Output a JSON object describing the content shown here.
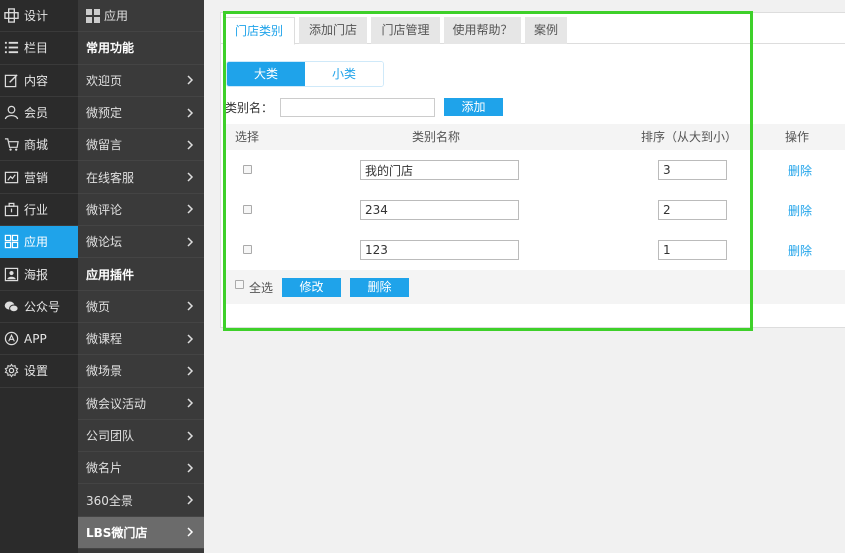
{
  "nav1": [
    {
      "label": "设计",
      "icon": "design-icon",
      "active": false
    },
    {
      "label": "栏目",
      "icon": "list-icon",
      "active": false
    },
    {
      "label": "内容",
      "icon": "edit-icon",
      "active": false
    },
    {
      "label": "会员",
      "icon": "user-icon",
      "active": false
    },
    {
      "label": "商城",
      "icon": "cart-icon",
      "active": false
    },
    {
      "label": "营销",
      "icon": "marketing-icon",
      "active": false
    },
    {
      "label": "行业",
      "icon": "briefcase-icon",
      "active": false
    },
    {
      "label": "应用",
      "icon": "apps-grid-icon",
      "active": true
    },
    {
      "label": "海报",
      "icon": "poster-icon",
      "active": false
    },
    {
      "label": "公众号",
      "icon": "wechat-icon",
      "active": false
    },
    {
      "label": "APP",
      "icon": "app-icon",
      "active": false
    },
    {
      "label": "设置",
      "icon": "gear-icon",
      "active": false
    }
  ],
  "nav2": {
    "title": "应用",
    "sections": [
      {
        "heading": "常用功能",
        "items": [
          "欢迎页",
          "微预定",
          "微留言",
          "在线客服",
          "微评论",
          "微论坛"
        ]
      },
      {
        "heading": "应用插件",
        "items": [
          "微页",
          "微课程",
          "微场景",
          "微会议活动",
          "公司团队",
          "微名片",
          "360全景",
          "LBS微门店"
        ]
      }
    ],
    "selected": "LBS微门店"
  },
  "tabs": [
    "门店类别",
    "添加门店",
    "门店管理",
    "使用帮助？",
    "案例"
  ],
  "active_tab": "门店类别",
  "segment": {
    "big": "大类",
    "small": "小类"
  },
  "add_form": {
    "label": "类别名：",
    "input_value": "",
    "button": "添加"
  },
  "table": {
    "headers": {
      "select": "选择",
      "name": "类别名称",
      "sort": "排序（从大到小）",
      "action": "操作"
    },
    "rows": [
      {
        "name": "我的门店",
        "sort": "3",
        "action": "删除"
      },
      {
        "name": "234",
        "sort": "2",
        "action": "删除"
      },
      {
        "name": "123",
        "sort": "1",
        "action": "删除"
      }
    ],
    "footer": {
      "select_all": "全选",
      "edit_button": "修改",
      "delete_button": "删除"
    }
  },
  "colors": {
    "accent": "#1fa3ea",
    "highlight": "#3ed02a",
    "sidebar_dark": "#2b2b2b",
    "sidebar_mid": "#3a3a3a"
  }
}
